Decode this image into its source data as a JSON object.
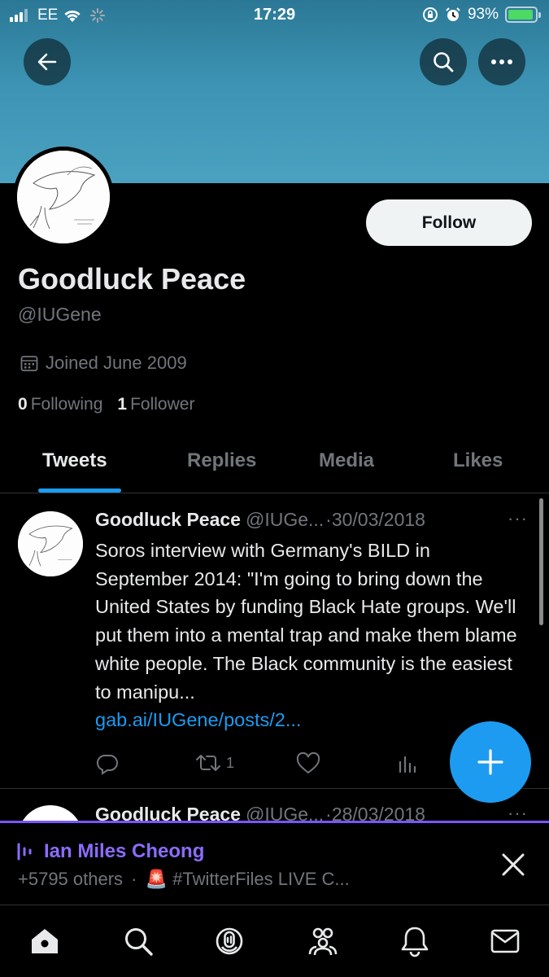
{
  "status_bar": {
    "carrier": "EE",
    "time": "17:29",
    "battery_percent": "93%",
    "battery_level": 0.93,
    "battery_color": "#4cd964"
  },
  "header": {
    "back_icon": "arrow-left-icon",
    "search_icon": "search-icon",
    "more_icon": "more-horizontal-icon",
    "banner_color": "#3c93b3"
  },
  "profile": {
    "display_name": "Goodluck Peace",
    "handle": "@IUGene",
    "joined": "Joined June 2009",
    "following_count": "0",
    "following_label": "Following",
    "followers_count": "1",
    "followers_label": "Follower",
    "follow_button": "Follow"
  },
  "tabs": [
    {
      "label": "Tweets",
      "active": true
    },
    {
      "label": "Replies",
      "active": false
    },
    {
      "label": "Media",
      "active": false
    },
    {
      "label": "Likes",
      "active": false
    }
  ],
  "tweets": [
    {
      "name": "Goodluck Peace",
      "handle": "@IUGe...",
      "date": "·30/03/2018",
      "more": "···",
      "text": "Soros interview with Germany's BILD in September 2014: \"I'm going to bring down the United States by funding Black Hate groups. We'll put them into a mental trap and make them blame white people. The Black community is the easiest to manipu...",
      "link": "gab.ai/IUGene/posts/2...",
      "retweets": "1"
    },
    {
      "name": "Goodluck Peace",
      "handle": "@IUGe...",
      "date": "·28/03/2018",
      "more": "···"
    }
  ],
  "space": {
    "host": "Ian Miles Cheong",
    "listeners": "+5795 others",
    "separator": "·",
    "emoji": "🚨",
    "title": "#TwitterFiles LIVE C..."
  },
  "nav": [
    "home-icon",
    "search-icon",
    "spaces-icon",
    "communities-icon",
    "notifications-icon",
    "messages-icon"
  ],
  "colors": {
    "accent": "#1d9bf0",
    "spaces": "#8c6cff"
  }
}
